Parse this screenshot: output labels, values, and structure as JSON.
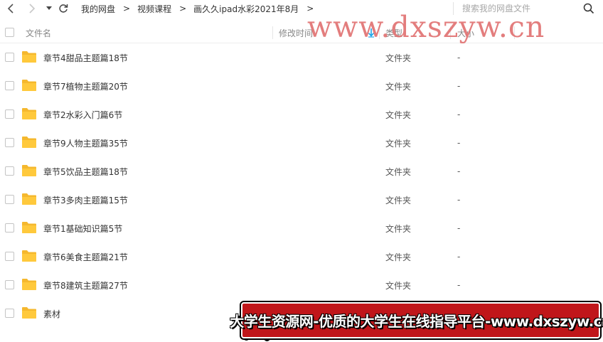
{
  "toolbar": {
    "back_icon": "‹",
    "forward_icon": "›",
    "history_icon": "▾",
    "breadcrumbs": [
      "我的网盘",
      "视频课程",
      "画久久ipad水彩2021年8月"
    ],
    "crumb_separator": ">",
    "search_placeholder": "搜索我的网盘文件"
  },
  "columns": {
    "name": "文件名",
    "modified": "修改时间",
    "type": "类型",
    "size": "大小"
  },
  "files": [
    {
      "name": "章节4甜品主题篇18节",
      "type": "文件夹",
      "size": "-"
    },
    {
      "name": "章节7植物主题篇20节",
      "type": "文件夹",
      "size": "-"
    },
    {
      "name": "章节2水彩入门篇6节",
      "type": "文件夹",
      "size": "-"
    },
    {
      "name": "章节9人物主题篇35节",
      "type": "文件夹",
      "size": "-"
    },
    {
      "name": "章节5饮品主题篇18节",
      "type": "文件夹",
      "size": "-"
    },
    {
      "name": "章节3多肉主题篇15节",
      "type": "文件夹",
      "size": "-"
    },
    {
      "name": "章节1基础知识篇5节",
      "type": "文件夹",
      "size": "-"
    },
    {
      "name": "章节6美食主题篇21节",
      "type": "文件夹",
      "size": "-"
    },
    {
      "name": "章节8建筑主题篇27节",
      "type": "文件夹",
      "size": "-"
    },
    {
      "name": "素材",
      "type": "",
      "size": ""
    }
  ],
  "watermark": {
    "url_text": "www.dxszyw.cn",
    "banner_text": "大学生资源网-优质的大学生在线指导平台-www.dxszyw.cn"
  },
  "colors": {
    "folder": "#ffc93c",
    "folder_dark": "#f5b82e",
    "sort_arrow": "#1aa3e8",
    "watermark": "#e07070",
    "banner_bg": "#c0161a"
  },
  "icons": {
    "folder": "folder-icon",
    "search": "search-icon",
    "refresh": "refresh-icon",
    "sort": "sort-down-icon"
  }
}
